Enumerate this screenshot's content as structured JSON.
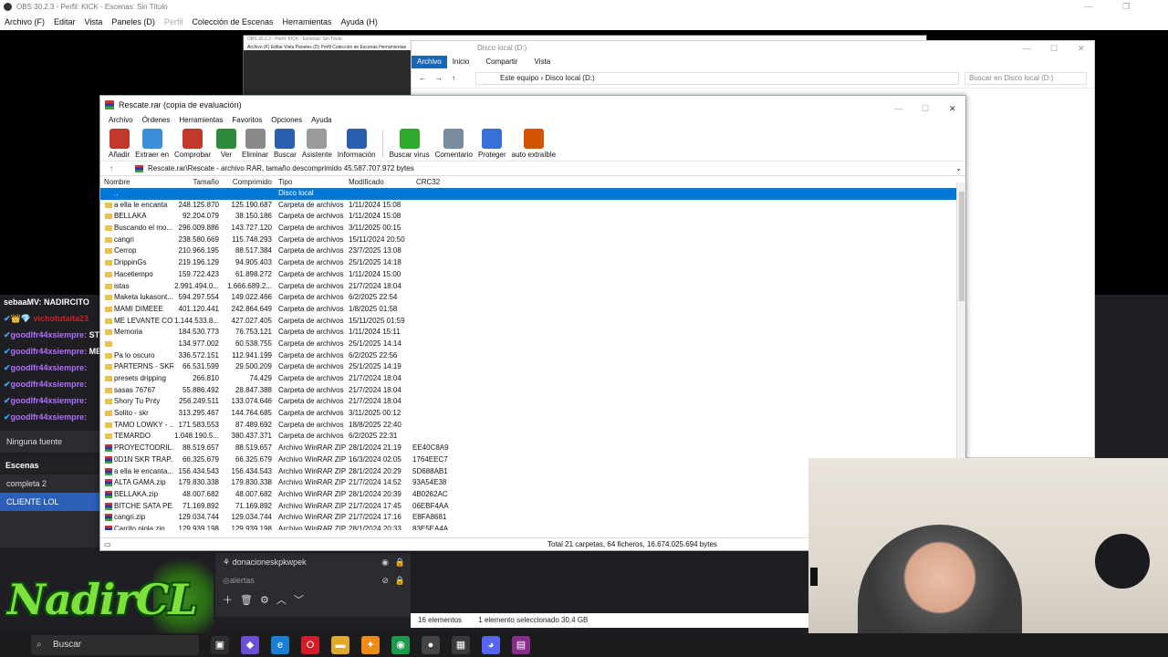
{
  "obs": {
    "title": "OBS 30.2.3 - Perfil: KICK - Escenas: Sin Título",
    "menu": [
      "Archivo (F)",
      "Editar",
      "Vista",
      "Paneles (D)",
      "Perfil",
      "Colección de Escenas",
      "Herramientas",
      "Ayuda (H)"
    ],
    "mini_title": "OBS 30.2.3 - Perfil: KICK - Escenas: Sin Título",
    "mini_menu": "Archivo (F)  Editar  Vista  Paneles (D)  Perfil  Colección de Escenas  Herramientas",
    "chat": [
      {
        "user": "sebaaMV:",
        "msg": "NADIRCITO"
      },
      {
        "user": "vichotutaita23",
        "msg": ""
      },
      {
        "user": "goodlfr44xsiempre:",
        "msg": "STUDIO"
      },
      {
        "user": "goodlfr44xsiempre:",
        "msg": "MEMORIES"
      },
      {
        "user": "goodlfr44xsiempre:",
        "msg": ""
      },
      {
        "user": "goodlfr44xsiempre:",
        "msg": ""
      },
      {
        "user": "goodlfr44xsiempre:",
        "msg": ""
      },
      {
        "user": "goodlfr44xsiempre:",
        "msg": ""
      }
    ],
    "no_source": "Ninguna fuente selecciona",
    "scenes_header": "Escenas",
    "scenes": [
      "completa 2",
      "CLIENTE LOL"
    ],
    "sources": [
      "donacioneskpkwpek",
      "alertas"
    ],
    "logo_text": "NadirCL"
  },
  "explorer": {
    "title": "Disco local (D:)",
    "tabs": [
      "Archivo",
      "Inicio",
      "Compartir",
      "Vista"
    ],
    "path": [
      "Este equipo",
      "Disco local (D:)"
    ],
    "search_placeholder": "Buscar en Disco local (D:)",
    "status_count": "16 elementos",
    "status_selected": "1 elemento seleccionado  30,4 GB"
  },
  "rar": {
    "title": "Rescate.rar (copia de evaluación)",
    "menu": [
      "Archivo",
      "Órdenes",
      "Herramientas",
      "Favoritos",
      "Opciones",
      "Ayuda"
    ],
    "toolbar": [
      {
        "label": "Añadir",
        "color": "#c0392b"
      },
      {
        "label": "Extraer en",
        "color": "#3b8fd9"
      },
      {
        "label": "Comprobar",
        "color": "#c0392b"
      },
      {
        "label": "Ver",
        "color": "#2e8b3e"
      },
      {
        "label": "Eliminar",
        "color": "#8a8a8a"
      },
      {
        "label": "Buscar",
        "color": "#2a5db0"
      },
      {
        "label": "Asistente",
        "color": "#9b9b9b"
      },
      {
        "label": "Información",
        "color": "#2a5db0"
      },
      {
        "label": "Buscar virus",
        "color": "#2ea92e"
      },
      {
        "label": "Comentario",
        "color": "#7a8ca0"
      },
      {
        "label": "Proteger",
        "color": "#3a6fd8"
      },
      {
        "label": "auto extraíble",
        "color": "#d35400"
      }
    ],
    "path": "Rescate.rar\\Rescate - archivo RAR, tamaño descomprimido 45.587.707.972 bytes",
    "columns": [
      "Nombre",
      "Tamaño",
      "Comprimido",
      "Tipo",
      "Modificado",
      "CRC32"
    ],
    "rows": [
      {
        "n": "..",
        "s": "",
        "c": "",
        "t": "Disco local",
        "m": "",
        "r": "",
        "kind": "up"
      },
      {
        "n": "a ella le encanta",
        "s": "248.125.870",
        "c": "125.190.687",
        "t": "Carpeta de archivos",
        "m": "1/11/2024 15:08",
        "r": "",
        "kind": "folder"
      },
      {
        "n": "BELLAKA",
        "s": "92.204.079",
        "c": "38.150.186",
        "t": "Carpeta de archivos",
        "m": "1/11/2024 15:08",
        "r": "",
        "kind": "folder"
      },
      {
        "n": "Buscando el mo...",
        "s": "296.009.886",
        "c": "143.727.120",
        "t": "Carpeta de archivos",
        "m": "3/11/2025 00:15",
        "r": "",
        "kind": "folder"
      },
      {
        "n": "cangri",
        "s": "238.580.669",
        "c": "115.748.293",
        "t": "Carpeta de archivos",
        "m": "15/11/2024 20:50",
        "r": "",
        "kind": "folder"
      },
      {
        "n": "Cerrop",
        "s": "210.966.195",
        "c": "88.517.384",
        "t": "Carpeta de archivos",
        "m": "23/7/2025 13:08",
        "r": "",
        "kind": "folder"
      },
      {
        "n": "DrippinGs",
        "s": "219.196.129",
        "c": "94.905.403",
        "t": "Carpeta de archivos",
        "m": "25/1/2025 14:18",
        "r": "",
        "kind": "folder"
      },
      {
        "n": "Hacetiempo",
        "s": "159.722.423",
        "c": "61.898.272",
        "t": "Carpeta de archivos",
        "m": "1/11/2024 15:00",
        "r": "",
        "kind": "folder"
      },
      {
        "n": "istas",
        "s": "2.991.494.0...",
        "c": "1.666.689.2...",
        "t": "Carpeta de archivos",
        "m": "21/7/2024 18:04",
        "r": "",
        "kind": "folder"
      },
      {
        "n": "Maketa lukasont...",
        "s": "594.297.554",
        "c": "149.022.466",
        "t": "Carpeta de archivos",
        "m": "6/2/2025 22:54",
        "r": "",
        "kind": "folder"
      },
      {
        "n": "MAMI DIMEEE",
        "s": "401.120.441",
        "c": "242.864.649",
        "t": "Carpeta de archivos",
        "m": "1/8/2025 01:58",
        "r": "",
        "kind": "folder"
      },
      {
        "n": "ME LEVANTE CO...",
        "s": "1.144.533.8...",
        "c": "427.027.405",
        "t": "Carpeta de archivos",
        "m": "15/11/2025 01:59",
        "r": "",
        "kind": "folder"
      },
      {
        "n": "Memoria",
        "s": "184.530.773",
        "c": "76.753.121",
        "t": "Carpeta de archivos",
        "m": "1/11/2024 15:11",
        "r": "",
        "kind": "folder"
      },
      {
        "n": "",
        "s": "134.977.002",
        "c": "60.538.755",
        "t": "Carpeta de archivos",
        "m": "25/1/2025 14:14",
        "r": "",
        "kind": "folder"
      },
      {
        "n": "Pa lo oscuro",
        "s": "336.572.151",
        "c": "112.941.199",
        "t": "Carpeta de archivos",
        "m": "6/2/2025 22:56",
        "r": "",
        "kind": "folder"
      },
      {
        "n": "PARTERNS - SKR...",
        "s": "66.531.599",
        "c": "29.500.209",
        "t": "Carpeta de archivos",
        "m": "25/1/2025 14:19",
        "r": "",
        "kind": "folder"
      },
      {
        "n": "presets dripping",
        "s": "266.810",
        "c": "74.429",
        "t": "Carpeta de archivos",
        "m": "21/7/2024 18:04",
        "r": "",
        "kind": "folder"
      },
      {
        "n": "sasas 76767",
        "s": "55.886.492",
        "c": "28.847.388",
        "t": "Carpeta de archivos",
        "m": "21/7/2024 18:04",
        "r": "",
        "kind": "folder"
      },
      {
        "n": "Shory Tu Pnty",
        "s": "256.249.511",
        "c": "133.074.646",
        "t": "Carpeta de archivos",
        "m": "21/7/2024 18:04",
        "r": "",
        "kind": "folder"
      },
      {
        "n": "Solito - skr",
        "s": "313.295.467",
        "c": "144.764.685",
        "t": "Carpeta de archivos",
        "m": "3/11/2025 00:12",
        "r": "",
        "kind": "folder"
      },
      {
        "n": "TAMO LOWKY - ...",
        "s": "171.583.553",
        "c": "87.489.692",
        "t": "Carpeta de archivos",
        "m": "18/8/2025 22:40",
        "r": "",
        "kind": "folder"
      },
      {
        "n": "TEMARDO",
        "s": "1.048.190.5...",
        "c": "380.437.371",
        "t": "Carpeta de archivos",
        "m": "6/2/2025 22:31",
        "r": "",
        "kind": "folder"
      },
      {
        "n": "PROYECTODRIL...",
        "s": "88.519.657",
        "c": "88.519.657",
        "t": "Archivo WinRAR ZIP",
        "m": "28/1/2024 21:19",
        "r": "EE40C8A9",
        "kind": "zip"
      },
      {
        "n": "0D1N SKR TRAP...",
        "s": "66.325.679",
        "c": "66.325.679",
        "t": "Archivo WinRAR ZIP",
        "m": "16/3/2024 02:05",
        "r": "1764EEC7",
        "kind": "zip"
      },
      {
        "n": "a ella le encanta...",
        "s": "156.434.543",
        "c": "156.434.543",
        "t": "Archivo WinRAR ZIP",
        "m": "28/1/2024 20:29",
        "r": "5D688AB1",
        "kind": "zip"
      },
      {
        "n": "ALTA GAMA.zip",
        "s": "179.830.338",
        "c": "179.830.338",
        "t": "Archivo WinRAR ZIP",
        "m": "21/7/2024 14:52",
        "r": "93A54E38",
        "kind": "zip"
      },
      {
        "n": "BELLAKA.zip",
        "s": "48.007.682",
        "c": "48.007.682",
        "t": "Archivo WinRAR ZIP",
        "m": "28/1/2024 20:39",
        "r": "4B0262AC",
        "kind": "zip"
      },
      {
        "n": "BITCHE SATA PE...",
        "s": "71.169.892",
        "c": "71.169.892",
        "t": "Archivo WinRAR ZIP",
        "m": "21/7/2024 17:45",
        "r": "06EBF4AA",
        "kind": "zip"
      },
      {
        "n": "cangri.zip",
        "s": "129.034.744",
        "c": "129.034.744",
        "t": "Archivo WinRAR ZIP",
        "m": "21/7/2024 17:16",
        "r": "E8FA8681",
        "kind": "zip"
      },
      {
        "n": "Carrito piola.zip",
        "s": "129.939.198",
        "c": "129.939.198",
        "t": "Archivo WinRAR ZIP",
        "m": "28/1/2024 20:33",
        "r": "83E5EA4A",
        "kind": "zip"
      }
    ],
    "status_total": "Total 21 carpetas, 64 ficheros, 16.674.025.694 bytes"
  },
  "taskbar": {
    "search": "Buscar",
    "apps": [
      {
        "name": "task-view-icon",
        "glyph": "▣",
        "color": "#2d2d2d"
      },
      {
        "name": "copilot-icon",
        "glyph": "◆",
        "color": "#6b4fd8"
      },
      {
        "name": "edge-icon",
        "glyph": "e",
        "color": "#1b7fd8"
      },
      {
        "name": "opera-icon",
        "glyph": "O",
        "color": "#d31d2a"
      },
      {
        "name": "explorer-icon",
        "glyph": "▬",
        "color": "#e0a82e"
      },
      {
        "name": "fl-studio-icon",
        "glyph": "✦",
        "color": "#f08a1a"
      },
      {
        "name": "app-green-icon",
        "glyph": "◉",
        "color": "#1d9b4d"
      },
      {
        "name": "obs-icon",
        "glyph": "●",
        "color": "#444"
      },
      {
        "name": "calculator-icon",
        "glyph": "▦",
        "color": "#3a3a3a"
      },
      {
        "name": "discord-icon",
        "glyph": "◕",
        "color": "#5865f2"
      },
      {
        "name": "winrar-icon",
        "glyph": "▤",
        "color": "#8a2c8a"
      }
    ]
  }
}
